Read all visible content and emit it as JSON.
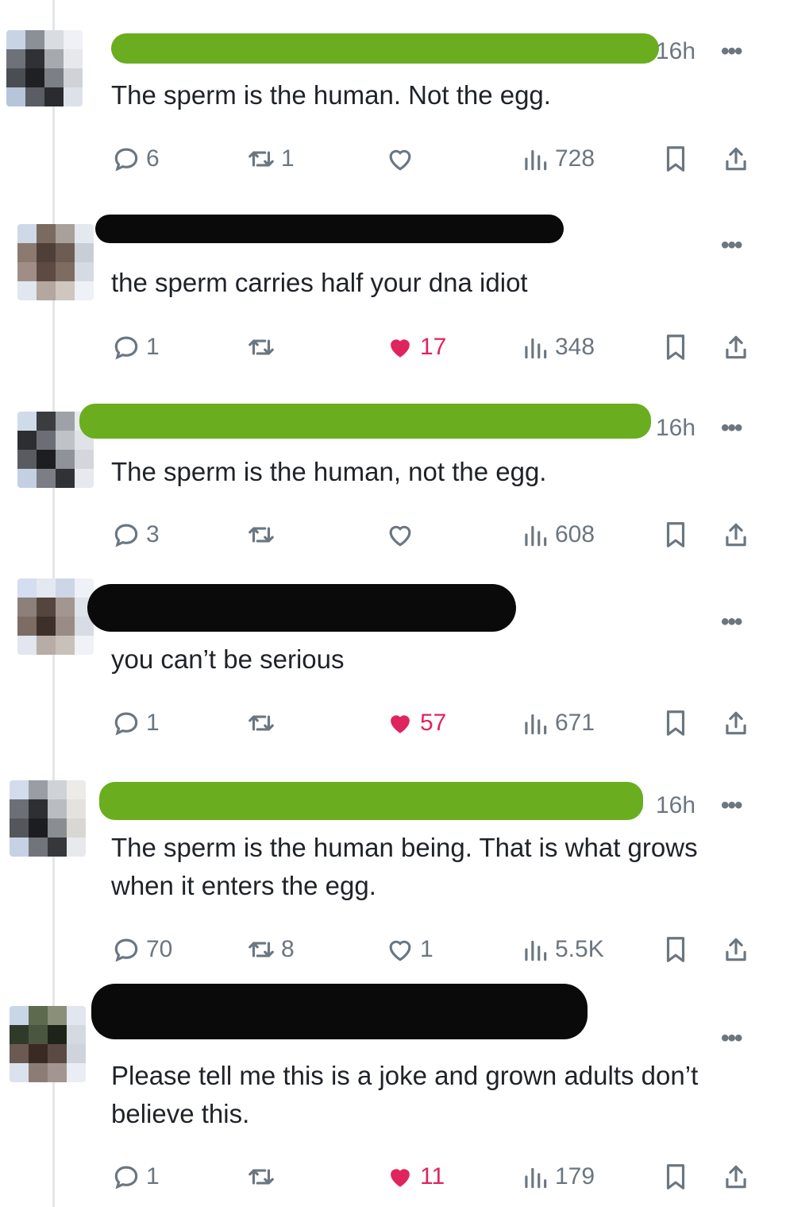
{
  "colors": {
    "like_active": "#e0245e",
    "muted": "#6b7680",
    "redact_green": "#6aad1f",
    "redact_black": "#0a0a0a"
  },
  "posts": [
    {
      "time": "16h",
      "more": "•••",
      "text": "The sperm is the human. Not the egg.",
      "replies": "6",
      "reposts": "1",
      "likes": "",
      "liked": false,
      "views": "728"
    },
    {
      "time": "",
      "more": "•••",
      "text": "the sperm carries half your dna idiot",
      "replies": "1",
      "reposts": "",
      "likes": "17",
      "liked": true,
      "views": "348"
    },
    {
      "time": "16h",
      "more": "•••",
      "text": "The sperm is the human, not the egg.",
      "replies": "3",
      "reposts": "",
      "likes": "",
      "liked": false,
      "views": "608"
    },
    {
      "time": "",
      "more": "•••",
      "text": "you can’t be serious",
      "replies": "1",
      "reposts": "",
      "likes": "57",
      "liked": true,
      "views": "671"
    },
    {
      "time": "16h",
      "more": "•••",
      "text": "The sperm is the human being. That is what grows when it enters the egg.",
      "replies": "70",
      "reposts": "8",
      "likes": "1",
      "liked": false,
      "views": "5.5K"
    },
    {
      "time": "",
      "more": "•••",
      "text": "Please tell me this is a joke and grown adults don’t believe this.",
      "replies": "1",
      "reposts": "",
      "likes": "11",
      "liked": true,
      "views": "179"
    }
  ]
}
